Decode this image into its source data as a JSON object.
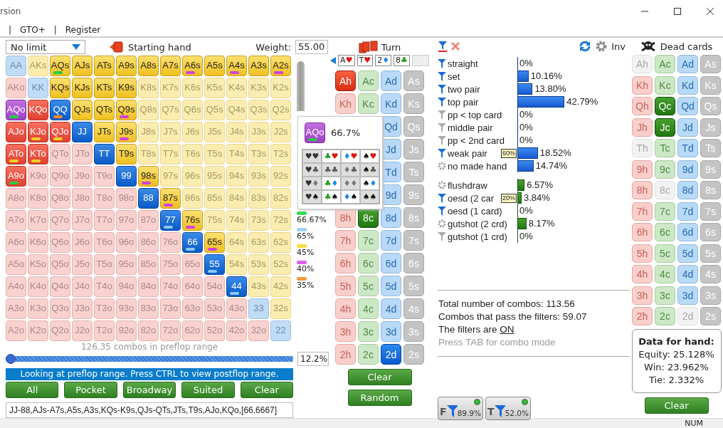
{
  "window": {
    "title": "rsion",
    "status": "NUM"
  },
  "menu": [
    "|",
    "GTO+",
    "|",
    "Register"
  ],
  "range_panel": {
    "game": "No limit",
    "starting_hand": "Starting hand",
    "weight_label": "Weight:",
    "weight": "55.00",
    "grid": [
      [
        {
          "label": "AA",
          "selected": false,
          "hovered": false
        },
        {
          "label": "AKs",
          "selected": false,
          "hovered": false
        },
        {
          "label": "AQs",
          "selected": true,
          "hovered": false,
          "color": "#22cc44"
        },
        {
          "label": "AJs",
          "selected": true,
          "hovered": false
        },
        {
          "label": "ATs",
          "selected": true,
          "hovered": false
        },
        {
          "label": "A9s",
          "selected": true,
          "hovered": false
        },
        {
          "label": "A8s",
          "selected": true,
          "hovered": false
        },
        {
          "label": "A7s",
          "selected": true,
          "hovered": false
        },
        {
          "label": "A6s",
          "selected": true,
          "hovered": false,
          "color": "#d040e0"
        },
        {
          "label": "A5s",
          "selected": true,
          "hovered": false
        },
        {
          "label": "A4s",
          "selected": true,
          "hovered": false,
          "color": "#d040e0"
        },
        {
          "label": "A3s",
          "selected": true,
          "hovered": false
        },
        {
          "label": "A2s",
          "selected": true,
          "hovered": false,
          "color": "#d040e0"
        }
      ],
      [
        {
          "label": "AKo",
          "selected": false,
          "hovered": false
        },
        {
          "label": "KK",
          "selected": false,
          "hovered": false
        },
        {
          "label": "KQs",
          "selected": true,
          "hovered": false
        },
        {
          "label": "KJs",
          "selected": true,
          "hovered": false
        },
        {
          "label": "KTs",
          "selected": true,
          "hovered": false
        },
        {
          "label": "K9s",
          "selected": true,
          "hovered": false
        },
        {
          "label": "K8s",
          "selected": false,
          "hovered": false
        },
        {
          "label": "K7s",
          "selected": false,
          "hovered": false
        },
        {
          "label": "K6s",
          "selected": false,
          "hovered": false
        },
        {
          "label": "K5s",
          "selected": false,
          "hovered": false
        },
        {
          "label": "K4s",
          "selected": false,
          "hovered": false
        },
        {
          "label": "K3s",
          "selected": false,
          "hovered": false
        },
        {
          "label": "K2s",
          "selected": false,
          "hovered": false
        }
      ],
      [
        {
          "label": "AQo",
          "selected": true,
          "hovered": true,
          "color": "#22cc44"
        },
        {
          "label": "KQo",
          "selected": true,
          "hovered": false
        },
        {
          "label": "QQ",
          "selected": true,
          "hovered": false,
          "color": "#f08a20"
        },
        {
          "label": "QJs",
          "selected": true,
          "hovered": false
        },
        {
          "label": "QTs",
          "selected": true,
          "hovered": false
        },
        {
          "label": "Q9s",
          "selected": true,
          "hovered": false,
          "color": "#d040e0"
        },
        {
          "label": "Q8s",
          "selected": false,
          "hovered": false
        },
        {
          "label": "Q7s",
          "selected": false,
          "hovered": false
        },
        {
          "label": "Q6s",
          "selected": false,
          "hovered": false
        },
        {
          "label": "Q5s",
          "selected": false,
          "hovered": false
        },
        {
          "label": "Q4s",
          "selected": false,
          "hovered": false
        },
        {
          "label": "Q3s",
          "selected": false,
          "hovered": false
        },
        {
          "label": "Q2s",
          "selected": false,
          "hovered": false
        }
      ],
      [
        {
          "label": "AJo",
          "selected": true,
          "hovered": false
        },
        {
          "label": "KJo",
          "selected": true,
          "hovered": false,
          "color": "#f0d020"
        },
        {
          "label": "QJo",
          "selected": true,
          "hovered": false,
          "color": "#f0d020"
        },
        {
          "label": "JJ",
          "selected": true,
          "hovered": false
        },
        {
          "label": "JTs",
          "selected": true,
          "hovered": false
        },
        {
          "label": "J9s",
          "selected": true,
          "hovered": false,
          "color": "#d040e0"
        },
        {
          "label": "J8s",
          "selected": false,
          "hovered": false
        },
        {
          "label": "J7s",
          "selected": false,
          "hovered": false
        },
        {
          "label": "J6s",
          "selected": false,
          "hovered": false
        },
        {
          "label": "J5s",
          "selected": false,
          "hovered": false
        },
        {
          "label": "J4s",
          "selected": false,
          "hovered": false
        },
        {
          "label": "J3s",
          "selected": false,
          "hovered": false
        },
        {
          "label": "J2s",
          "selected": false,
          "hovered": false
        }
      ],
      [
        {
          "label": "ATo",
          "selected": true,
          "hovered": false,
          "color": "#f0d020"
        },
        {
          "label": "KTo",
          "selected": true,
          "hovered": false,
          "color": "#f0d020"
        },
        {
          "label": "QTo",
          "selected": false,
          "hovered": false
        },
        {
          "label": "JTo",
          "selected": false,
          "hovered": false
        },
        {
          "label": "TT",
          "selected": true,
          "hovered": false
        },
        {
          "label": "T9s",
          "selected": true,
          "hovered": false
        },
        {
          "label": "T8s",
          "selected": false,
          "hovered": false
        },
        {
          "label": "T7s",
          "selected": false,
          "hovered": false
        },
        {
          "label": "T6s",
          "selected": false,
          "hovered": false
        },
        {
          "label": "T5s",
          "selected": false,
          "hovered": false
        },
        {
          "label": "T4s",
          "selected": false,
          "hovered": false
        },
        {
          "label": "T3s",
          "selected": false,
          "hovered": false
        },
        {
          "label": "T2s",
          "selected": false,
          "hovered": false
        }
      ],
      [
        {
          "label": "A9o",
          "selected": true,
          "hovered": false,
          "color": "#22cc44"
        },
        {
          "label": "K9o",
          "selected": false,
          "hovered": false
        },
        {
          "label": "Q9o",
          "selected": false,
          "hovered": false
        },
        {
          "label": "J9o",
          "selected": false,
          "hovered": false
        },
        {
          "label": "T9o",
          "selected": false,
          "hovered": false
        },
        {
          "label": "99",
          "selected": true,
          "hovered": false
        },
        {
          "label": "98s",
          "selected": true,
          "hovered": false,
          "color": "#d040e0"
        },
        {
          "label": "97s",
          "selected": false,
          "hovered": false
        },
        {
          "label": "96s",
          "selected": false,
          "hovered": false
        },
        {
          "label": "95s",
          "selected": false,
          "hovered": false
        },
        {
          "label": "94s",
          "selected": false,
          "hovered": false
        },
        {
          "label": "93s",
          "selected": false,
          "hovered": false
        },
        {
          "label": "92s",
          "selected": false,
          "hovered": false
        }
      ],
      [
        {
          "label": "A8o",
          "selected": false,
          "hovered": false
        },
        {
          "label": "K8o",
          "selected": false,
          "hovered": false
        },
        {
          "label": "Q8o",
          "selected": false,
          "hovered": false
        },
        {
          "label": "J8o",
          "selected": false,
          "hovered": false
        },
        {
          "label": "T8o",
          "selected": false,
          "hovered": false
        },
        {
          "label": "98o",
          "selected": false,
          "hovered": false
        },
        {
          "label": "88",
          "selected": true,
          "hovered": false
        },
        {
          "label": "87s",
          "selected": true,
          "hovered": false,
          "color": "#d040e0"
        },
        {
          "label": "86s",
          "selected": false,
          "hovered": false
        },
        {
          "label": "85s",
          "selected": false,
          "hovered": false
        },
        {
          "label": "84s",
          "selected": false,
          "hovered": false
        },
        {
          "label": "83s",
          "selected": false,
          "hovered": false
        },
        {
          "label": "82s",
          "selected": false,
          "hovered": false
        }
      ],
      [
        {
          "label": "A7o",
          "selected": false,
          "hovered": false
        },
        {
          "label": "K7o",
          "selected": false,
          "hovered": false
        },
        {
          "label": "Q7o",
          "selected": false,
          "hovered": false
        },
        {
          "label": "J7o",
          "selected": false,
          "hovered": false
        },
        {
          "label": "T7o",
          "selected": false,
          "hovered": false
        },
        {
          "label": "97o",
          "selected": false,
          "hovered": false
        },
        {
          "label": "87o",
          "selected": false,
          "hovered": false
        },
        {
          "label": "77",
          "selected": true,
          "hovered": false,
          "color": "#8cc8f0"
        },
        {
          "label": "76s",
          "selected": true,
          "hovered": false,
          "color": "#d040e0"
        },
        {
          "label": "75s",
          "selected": false,
          "hovered": false
        },
        {
          "label": "74s",
          "selected": false,
          "hovered": false
        },
        {
          "label": "73s",
          "selected": false,
          "hovered": false
        },
        {
          "label": "72s",
          "selected": false,
          "hovered": false
        }
      ],
      [
        {
          "label": "A6o",
          "selected": false,
          "hovered": false
        },
        {
          "label": "K6o",
          "selected": false,
          "hovered": false
        },
        {
          "label": "Q6o",
          "selected": false,
          "hovered": false
        },
        {
          "label": "J6o",
          "selected": false,
          "hovered": false
        },
        {
          "label": "T6o",
          "selected": false,
          "hovered": false
        },
        {
          "label": "96o",
          "selected": false,
          "hovered": false
        },
        {
          "label": "86o",
          "selected": false,
          "hovered": false
        },
        {
          "label": "76o",
          "selected": false,
          "hovered": false
        },
        {
          "label": "66",
          "selected": true,
          "hovered": false,
          "color": "#8cc8f0"
        },
        {
          "label": "65s",
          "selected": true,
          "hovered": false,
          "color": "#d040e0"
        },
        {
          "label": "64s",
          "selected": false,
          "hovered": false
        },
        {
          "label": "63s",
          "selected": false,
          "hovered": false
        },
        {
          "label": "62s",
          "selected": false,
          "hovered": false
        }
      ],
      [
        {
          "label": "A5o",
          "selected": false,
          "hovered": false
        },
        {
          "label": "K5o",
          "selected": false,
          "hovered": false
        },
        {
          "label": "Q5o",
          "selected": false,
          "hovered": false
        },
        {
          "label": "J5o",
          "selected": false,
          "hovered": false
        },
        {
          "label": "T5o",
          "selected": false,
          "hovered": false
        },
        {
          "label": "95o",
          "selected": false,
          "hovered": false
        },
        {
          "label": "85o",
          "selected": false,
          "hovered": false
        },
        {
          "label": "75o",
          "selected": false,
          "hovered": false
        },
        {
          "label": "65o",
          "selected": false,
          "hovered": false
        },
        {
          "label": "55",
          "selected": true,
          "hovered": false,
          "color": "#8cc8f0"
        },
        {
          "label": "54s",
          "selected": false,
          "hovered": false
        },
        {
          "label": "53s",
          "selected": false,
          "hovered": false
        },
        {
          "label": "52s",
          "selected": false,
          "hovered": false
        }
      ],
      [
        {
          "label": "A4o",
          "selected": false,
          "hovered": false
        },
        {
          "label": "K4o",
          "selected": false,
          "hovered": false
        },
        {
          "label": "Q4o",
          "selected": false,
          "hovered": false
        },
        {
          "label": "J4o",
          "selected": false,
          "hovered": false
        },
        {
          "label": "T4o",
          "selected": false,
          "hovered": false
        },
        {
          "label": "94o",
          "selected": false,
          "hovered": false
        },
        {
          "label": "84o",
          "selected": false,
          "hovered": false
        },
        {
          "label": "74o",
          "selected": false,
          "hovered": false
        },
        {
          "label": "64o",
          "selected": false,
          "hovered": false
        },
        {
          "label": "54o",
          "selected": false,
          "hovered": false
        },
        {
          "label": "44",
          "selected": true,
          "hovered": false,
          "color": "#8cc8f0"
        },
        {
          "label": "43s",
          "selected": false,
          "hovered": false
        },
        {
          "label": "42s",
          "selected": false,
          "hovered": false
        }
      ],
      [
        {
          "label": "A3o",
          "selected": false,
          "hovered": false
        },
        {
          "label": "K3o",
          "selected": false,
          "hovered": false
        },
        {
          "label": "Q3o",
          "selected": false,
          "hovered": false
        },
        {
          "label": "J3o",
          "selected": false,
          "hovered": false
        },
        {
          "label": "T3o",
          "selected": false,
          "hovered": false
        },
        {
          "label": "93o",
          "selected": false,
          "hovered": false
        },
        {
          "label": "83o",
          "selected": false,
          "hovered": false
        },
        {
          "label": "73o",
          "selected": false,
          "hovered": false
        },
        {
          "label": "63o",
          "selected": false,
          "hovered": false
        },
        {
          "label": "53o",
          "selected": false,
          "hovered": false
        },
        {
          "label": "43o",
          "selected": false,
          "hovered": false
        },
        {
          "label": "33",
          "selected": false,
          "hovered": false
        },
        {
          "label": "32s",
          "selected": false,
          "hovered": false
        }
      ],
      [
        {
          "label": "A2o",
          "selected": false,
          "hovered": false
        },
        {
          "label": "K2o",
          "selected": false,
          "hovered": false
        },
        {
          "label": "Q2o",
          "selected": false,
          "hovered": false
        },
        {
          "label": "J2o",
          "selected": false,
          "hovered": false
        },
        {
          "label": "T2o",
          "selected": false,
          "hovered": false
        },
        {
          "label": "92o",
          "selected": false,
          "hovered": false
        },
        {
          "label": "82o",
          "selected": false,
          "hovered": false
        },
        {
          "label": "72o",
          "selected": false,
          "hovered": false
        },
        {
          "label": "62o",
          "selected": false,
          "hovered": false
        },
        {
          "label": "52o",
          "selected": false,
          "hovered": false
        },
        {
          "label": "42o",
          "selected": false,
          "hovered": false
        },
        {
          "label": "32o",
          "selected": false,
          "hovered": false
        },
        {
          "label": "22",
          "selected": false,
          "hovered": false
        }
      ]
    ],
    "legend": [
      {
        "label": "66.67%",
        "color": "#33dd55"
      },
      {
        "label": "65%",
        "color": "#9fd0f5"
      },
      {
        "label": "45%",
        "color": "#f5e040"
      },
      {
        "label": "40%",
        "color": "#e060f0"
      },
      {
        "label": "35%",
        "color": "#f09a40"
      }
    ],
    "combos": "126.35 combos in preflop range",
    "slider": {
      "level": 0
    },
    "percent": "12.2%",
    "info": "Looking at preflop range. Press CTRL to view postflop range.",
    "buttons": [
      "All",
      "Pocket",
      "Broadway",
      "Suited",
      "Clear"
    ],
    "range_text": "JJ-88,AJs-A7s,A5s,A3s,KQs-K9s,QJs-QTs,JTs,T9s,AJo,KQo,[66.6667]"
  },
  "popup": {
    "hand": "AQo",
    "color": "#22cc44",
    "percent": "66.7%",
    "combos": [
      [
        {
          "selected": false,
          "suits": [
            {
              "s": "♥",
              "color": "#333333"
            },
            {
              "s": "♥",
              "color": "#333333"
            }
          ]
        },
        {
          "selected": true,
          "suits": [
            {
              "s": "♣",
              "color": "#1a9a1a"
            },
            {
              "s": "♥",
              "color": "#e01010"
            }
          ]
        },
        {
          "selected": true,
          "suits": [
            {
              "s": "♦",
              "color": "#1a8ae8"
            },
            {
              "s": "♥",
              "color": "#e01010"
            }
          ]
        },
        {
          "selected": true,
          "suits": [
            {
              "s": "♠",
              "color": "#111111"
            },
            {
              "s": "♥",
              "color": "#e01010"
            }
          ]
        }
      ],
      [
        {
          "selected": false,
          "suits": [
            {
              "s": "♥",
              "color": "#333333"
            },
            {
              "s": "♣",
              "color": "#555555"
            }
          ]
        },
        {
          "selected": false,
          "suits": [
            {
              "s": "♣",
              "color": "#555555"
            },
            {
              "s": "♣",
              "color": "#555555"
            }
          ]
        },
        {
          "selected": false,
          "suits": [
            {
              "s": "♦",
              "color": "#777777"
            },
            {
              "s": "♣",
              "color": "#555555"
            }
          ]
        },
        {
          "selected": false,
          "suits": [
            {
              "s": "♠",
              "color": "#111111"
            },
            {
              "s": "♣",
              "color": "#555555"
            }
          ]
        }
      ],
      [
        {
          "selected": false,
          "suits": [
            {
              "s": "♥",
              "color": "#333333"
            },
            {
              "s": "♦",
              "color": "#777777"
            }
          ]
        },
        {
          "selected": true,
          "suits": [
            {
              "s": "♣",
              "color": "#1a9a1a"
            },
            {
              "s": "♦",
              "color": "#1a8ae8"
            }
          ]
        },
        {
          "selected": false,
          "suits": [
            {
              "s": "♦",
              "color": "#777777"
            },
            {
              "s": "♦",
              "color": "#777777"
            }
          ]
        },
        {
          "selected": true,
          "suits": [
            {
              "s": "♠",
              "color": "#111111"
            },
            {
              "s": "♦",
              "color": "#1a8ae8"
            }
          ]
        }
      ],
      [
        {
          "selected": false,
          "suits": [
            {
              "s": "♥",
              "color": "#333333"
            },
            {
              "s": "♠",
              "color": "#111111"
            }
          ]
        },
        {
          "selected": true,
          "suits": [
            {
              "s": "♣",
              "color": "#1a9a1a"
            },
            {
              "s": "♠",
              "color": "#111111"
            }
          ]
        },
        {
          "selected": true,
          "suits": [
            {
              "s": "♦",
              "color": "#1a8ae8"
            },
            {
              "s": "♠",
              "color": "#111111"
            }
          ]
        },
        {
          "selected": false,
          "suits": [
            {
              "s": "♠",
              "color": "#111111"
            },
            {
              "s": "♠",
              "color": "#111111"
            }
          ]
        }
      ]
    ]
  },
  "turn_panel": {
    "title": "Turn",
    "board": [
      {
        "rank": "A",
        "suit": "♥",
        "color": "#e01010"
      },
      {
        "rank": "T",
        "suit": "♥",
        "color": "#e01010"
      },
      {
        "rank": "2",
        "suit": "♦",
        "color": "#1a8ae8"
      },
      {
        "rank": "8",
        "suit": "♣",
        "color": "#1a9a1a"
      }
    ],
    "cards": [
      [
        {
          "label": "Ah",
          "selected": true
        },
        {
          "label": "Ac",
          "selected": false
        },
        {
          "label": "Ad",
          "selected": false
        },
        {
          "label": "As",
          "selected": false
        }
      ],
      [
        {
          "label": "Kh",
          "selected": false
        },
        {
          "label": "Kc",
          "selected": false
        },
        {
          "label": "Kd",
          "selected": false
        },
        {
          "label": "Ks",
          "selected": false
        }
      ],
      [
        {
          "label": "Qd",
          "selected": false
        },
        {
          "label": "Qs",
          "selected": false
        }
      ],
      [
        {
          "label": "Jd",
          "selected": false
        },
        {
          "label": "Js",
          "selected": false
        }
      ],
      [
        {
          "label": "Td",
          "selected": false
        },
        {
          "label": "Ts",
          "selected": false
        }
      ],
      [
        {
          "label": "9d",
          "selected": false
        },
        {
          "label": "9s",
          "selected": false
        }
      ],
      [
        {
          "label": "8h",
          "selected": false
        },
        {
          "label": "8c",
          "selected": true
        },
        {
          "label": "8d",
          "selected": false
        },
        {
          "label": "8s",
          "selected": false
        }
      ],
      [
        {
          "label": "7h",
          "selected": false
        },
        {
          "label": "7c",
          "selected": false
        },
        {
          "label": "7d",
          "selected": false
        },
        {
          "label": "7s",
          "selected": false
        }
      ],
      [
        {
          "label": "6h",
          "selected": false
        },
        {
          "label": "6c",
          "selected": false
        },
        {
          "label": "6d",
          "selected": false
        },
        {
          "label": "6s",
          "selected": false
        }
      ],
      [
        {
          "label": "5h",
          "selected": false
        },
        {
          "label": "5c",
          "selected": false
        },
        {
          "label": "5d",
          "selected": false
        },
        {
          "label": "5s",
          "selected": false
        }
      ],
      [
        {
          "label": "4h",
          "selected": false
        },
        {
          "label": "4c",
          "selected": false
        },
        {
          "label": "4d",
          "selected": false
        },
        {
          "label": "4s",
          "selected": false
        }
      ],
      [
        {
          "label": "3h",
          "selected": false
        },
        {
          "label": "3c",
          "selected": false
        },
        {
          "label": "3d",
          "selected": false
        },
        {
          "label": "3s",
          "selected": false
        }
      ],
      [
        {
          "label": "2h",
          "selected": false
        },
        {
          "label": "2c",
          "selected": false
        },
        {
          "label": "2d",
          "selected": true
        },
        {
          "label": "2s",
          "selected": false
        }
      ]
    ],
    "buttons": [
      "Clear",
      "Random"
    ]
  },
  "filters_panel": {
    "inv": "Inv",
    "made_hands": [
      {
        "kind": "filter",
        "label": "straight",
        "level": 0,
        "reading": "0%"
      },
      {
        "kind": "filter",
        "label": "set",
        "level": 0.1016,
        "reading": "10.16%"
      },
      {
        "kind": "filter",
        "label": "two pair",
        "level": 0.138,
        "reading": "13.80%"
      },
      {
        "kind": "filter",
        "label": "top pair",
        "level": 0.4279,
        "reading": "42.79%"
      },
      {
        "kind": "filter-off",
        "label": "pp < top card",
        "level": 0,
        "reading": "0%"
      },
      {
        "kind": "filter-off",
        "label": "middle pair",
        "level": 0,
        "reading": "0%"
      },
      {
        "kind": "filter-off",
        "label": "pp < 2nd card",
        "level": 0,
        "reading": "0%"
      },
      {
        "kind": "filter",
        "label": "weak pair",
        "tag": "60%",
        "level": 0.1852,
        "reading": "18.52%"
      },
      {
        "kind": "gear",
        "label": "no made hand",
        "level": 0.1474,
        "reading": "14.74%"
      }
    ],
    "draws": [
      {
        "kind": "gear",
        "label": "flushdraw",
        "level": 0.0657,
        "reading": "6.57%"
      },
      {
        "kind": "filter",
        "label": "oesd (2 car",
        "tag": "20%",
        "level": 0.0384,
        "reading": "3.84%"
      },
      {
        "kind": "filter",
        "label": "oesd (1 card)",
        "level": 0,
        "reading": "0%"
      },
      {
        "kind": "gear",
        "label": "gutshot (2 crd)",
        "level": 0.0817,
        "reading": "8.17%"
      },
      {
        "kind": "filter-off",
        "label": "gutshot (1 crd)",
        "level": 0,
        "reading": "0%"
      }
    ],
    "total": "Total number of combos: 113.56",
    "passing": "Combos that pass the filters: 59.07",
    "filters_state": "The filters are",
    "filters_link": "ON",
    "hint": "Press TAB for combo mode",
    "toggles": [
      {
        "letter": "F",
        "value": "89.9%",
        "on": true
      },
      {
        "letter": "T",
        "value": "52.0%",
        "on": true
      }
    ]
  },
  "dead_panel": {
    "title": "Dead cards",
    "cards": [
      [
        {
          "label": "Ah",
          "selected": false,
          "dead": true
        },
        {
          "label": "Ac",
          "selected": false,
          "dead": false
        },
        {
          "label": "Ad",
          "selected": false,
          "dead": false
        },
        {
          "label": "As",
          "selected": false,
          "dead": false
        }
      ],
      [
        {
          "label": "Kh",
          "selected": false,
          "dead": false
        },
        {
          "label": "Kc",
          "selected": false,
          "dead": false
        },
        {
          "label": "Kd",
          "selected": false,
          "dead": false
        },
        {
          "label": "Ks",
          "selected": false,
          "dead": false
        }
      ],
      [
        {
          "label": "Qh",
          "selected": false,
          "dead": false
        },
        {
          "label": "Qc",
          "selected": true,
          "dead": false
        },
        {
          "label": "Qd",
          "selected": false,
          "dead": false
        },
        {
          "label": "Qs",
          "selected": false,
          "dead": false
        }
      ],
      [
        {
          "label": "Jh",
          "selected": false,
          "dead": false
        },
        {
          "label": "Jc",
          "selected": true,
          "dead": false
        },
        {
          "label": "Jd",
          "selected": false,
          "dead": false
        },
        {
          "label": "Js",
          "selected": false,
          "dead": false
        }
      ],
      [
        {
          "label": "Th",
          "selected": false,
          "dead": true
        },
        {
          "label": "Tc",
          "selected": false,
          "dead": false
        },
        {
          "label": "Td",
          "selected": false,
          "dead": false
        },
        {
          "label": "Ts",
          "selected": false,
          "dead": false
        }
      ],
      [
        {
          "label": "9h",
          "selected": false,
          "dead": false
        },
        {
          "label": "9c",
          "selected": false,
          "dead": false
        },
        {
          "label": "9d",
          "selected": false,
          "dead": false
        },
        {
          "label": "9s",
          "selected": false,
          "dead": false
        }
      ],
      [
        {
          "label": "8h",
          "selected": false,
          "dead": false
        },
        {
          "label": "8c",
          "selected": false,
          "dead": true
        },
        {
          "label": "8d",
          "selected": false,
          "dead": false
        },
        {
          "label": "8s",
          "selected": false,
          "dead": false
        }
      ],
      [
        {
          "label": "7h",
          "selected": false,
          "dead": false
        },
        {
          "label": "7c",
          "selected": false,
          "dead": false
        },
        {
          "label": "7d",
          "selected": false,
          "dead": false
        },
        {
          "label": "7s",
          "selected": false,
          "dead": false
        }
      ],
      [
        {
          "label": "6h",
          "selected": false,
          "dead": false
        },
        {
          "label": "6c",
          "selected": false,
          "dead": false
        },
        {
          "label": "6d",
          "selected": false,
          "dead": false
        },
        {
          "label": "6s",
          "selected": false,
          "dead": false
        }
      ],
      [
        {
          "label": "5h",
          "selected": false,
          "dead": false
        },
        {
          "label": "5c",
          "selected": false,
          "dead": false
        },
        {
          "label": "5d",
          "selected": false,
          "dead": false
        },
        {
          "label": "5s",
          "selected": false,
          "dead": false
        }
      ],
      [
        {
          "label": "4h",
          "selected": false,
          "dead": false
        },
        {
          "label": "4c",
          "selected": false,
          "dead": false
        },
        {
          "label": "4d",
          "selected": false,
          "dead": false
        },
        {
          "label": "4s",
          "selected": false,
          "dead": false
        }
      ],
      [
        {
          "label": "3h",
          "selected": false,
          "dead": false
        },
        {
          "label": "3c",
          "selected": false,
          "dead": false
        },
        {
          "label": "3d",
          "selected": false,
          "dead": false
        },
        {
          "label": "3s",
          "selected": false,
          "dead": false
        }
      ],
      [
        {
          "label": "2h",
          "selected": false,
          "dead": false
        },
        {
          "label": "2c",
          "selected": false,
          "dead": false
        },
        {
          "label": "2d",
          "selected": false,
          "dead": true
        },
        {
          "label": "2s",
          "selected": false,
          "dead": false
        }
      ]
    ],
    "data_title": "Data for hand:",
    "data_lines": [
      "Equity: 25.128%",
      "Win: 23.962%",
      "Tie: 2.332%"
    ],
    "button": "Clear"
  }
}
